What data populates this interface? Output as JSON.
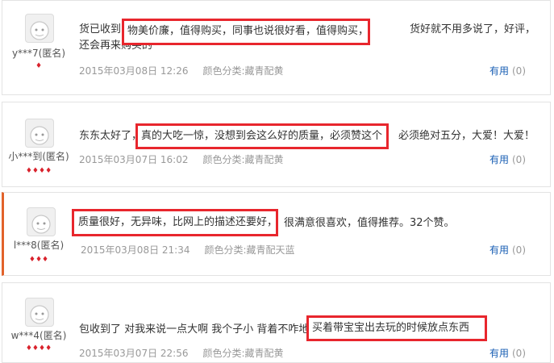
{
  "reviews": [
    {
      "username": "y***7(匿名)",
      "level": "♦",
      "content_before": "货已收到，",
      "highlight": "物美价廉，值得购买，同事也说很好看，值得购买，",
      "content_after": "货好就不用多说了，好评，还会再来购买的",
      "date": "2015年03月08日 12:26",
      "color_label": "颜色分类:藏青配黄",
      "useful_label": "有用",
      "useful_count": "(0)"
    },
    {
      "username": "小***到(匿名)",
      "level": "♦♦♦♦",
      "content_before": "东东太好了，",
      "highlight": "真的大吃一惊，没想到会这么好的质量，必须赞这个",
      "content_after": "必须绝对五分，大爱！大爱！",
      "date": "2015年03月07日 16:02",
      "color_label": "颜色分类:藏青配黄",
      "useful_label": "有用",
      "useful_count": "(0)"
    },
    {
      "username": "l***8(匿名)",
      "level": "♦♦♦",
      "content_before": "",
      "highlight": "质量很好，无异味，比网上的描述还要好，",
      "content_after": "很满意很喜欢，值得推荐。32个赞。",
      "date": "2015年03月08日 21:34",
      "color_label": "颜色分类:藏青配天蓝",
      "useful_label": "有用",
      "useful_count": "(0)"
    },
    {
      "username": "w***4(匿名)",
      "level": "♦♦♦♦",
      "content_before": "包收到了 对我来说一点大啊 我个子小 背着不咋地",
      "highlight": "买着带宝宝出去玩的时候放点东西",
      "content_after": "",
      "date": "2015年03月07日 22:56",
      "color_label": "颜色分类:藏青配黄",
      "useful_label": "有用",
      "useful_count": "(0)"
    }
  ]
}
